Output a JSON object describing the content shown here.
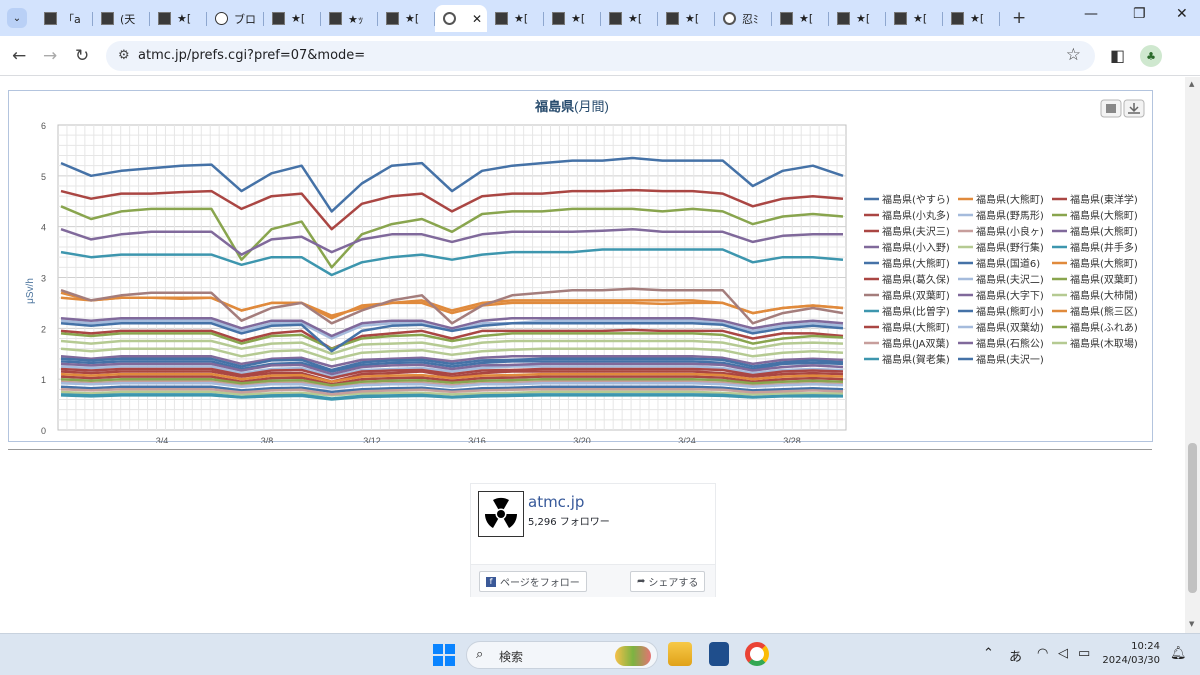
{
  "browser": {
    "tabs": [
      {
        "label": "「a",
        "icon": "square-favicon"
      },
      {
        "label": "(天",
        "icon": "square-favicon"
      },
      {
        "label": "★[",
        "icon": "square-favicon"
      },
      {
        "label": "ブロ",
        "icon": "info-favicon"
      },
      {
        "label": "★[",
        "icon": "square-favicon"
      },
      {
        "label": "★ｯ",
        "icon": "square-favicon"
      },
      {
        "label": "★[",
        "icon": "square-favicon"
      },
      {
        "label": "",
        "icon": "globe-favicon",
        "active": true
      },
      {
        "label": "★[",
        "icon": "square-favicon"
      },
      {
        "label": "★[",
        "icon": "square-favicon"
      },
      {
        "label": "★[",
        "icon": "square-favicon"
      },
      {
        "label": "★[",
        "icon": "square-favicon"
      },
      {
        "label": "忍ﾐ",
        "icon": "globe-favicon"
      },
      {
        "label": "★[",
        "icon": "square-favicon"
      },
      {
        "label": "★[",
        "icon": "square-favicon"
      },
      {
        "label": "★[",
        "icon": "square-favicon"
      },
      {
        "label": "★[",
        "icon": "square-favicon"
      }
    ],
    "close_tab": "✕",
    "new_tab": "+",
    "url": "atmc.jp/prefs.cgi?pref=07&mode="
  },
  "chart_data": {
    "type": "line",
    "title": "福島県",
    "title_suffix": "(月間)",
    "ylabel": "μSv/h",
    "ylim": [
      0,
      6
    ],
    "yticks": [
      "0",
      "1",
      "2",
      "3",
      "4",
      "5",
      "6"
    ],
    "xticks": [
      "3/4",
      "3/8",
      "3/12",
      "3/16",
      "3/20",
      "3/24",
      "3/28"
    ],
    "grid": true,
    "legend_position": "right",
    "series": [
      {
        "name": "福島県(やすら)",
        "color": "#4572a7",
        "values": [
          5.25,
          5.0,
          5.1,
          5.15,
          5.2,
          5.22,
          4.7,
          5.05,
          5.2,
          4.3,
          4.85,
          5.2,
          5.25,
          4.7,
          5.1,
          5.2,
          5.25,
          5.3,
          5.3,
          5.35,
          5.3,
          5.3,
          5.3,
          4.8,
          5.1,
          5.2,
          5.0
        ]
      },
      {
        "name": "福島県(大熊町)",
        "color": "#e08a3c",
        "values": [
          2.6,
          2.55,
          2.6,
          2.6,
          2.58,
          2.6,
          2.35,
          2.5,
          2.5,
          2.25,
          2.4,
          2.5,
          2.5,
          2.3,
          2.45,
          2.5,
          2.5,
          2.5,
          2.5,
          2.5,
          2.48,
          2.5,
          2.5,
          2.3,
          2.4,
          2.45,
          2.4
        ]
      },
      {
        "name": "福島県(東洋学)",
        "color": "#aa4643",
        "values": [
          4.7,
          4.55,
          4.65,
          4.65,
          4.68,
          4.7,
          4.35,
          4.6,
          4.65,
          3.95,
          4.45,
          4.6,
          4.65,
          4.3,
          4.6,
          4.65,
          4.65,
          4.7,
          4.7,
          4.72,
          4.7,
          4.7,
          4.65,
          4.4,
          4.55,
          4.6,
          4.55
        ]
      },
      {
        "name": "福島県(小丸多)",
        "color": "#aa4643",
        "values": [
          1.95,
          1.9,
          1.95,
          1.95,
          1.95,
          1.95,
          1.75,
          1.9,
          1.95,
          1.6,
          1.85,
          1.9,
          1.95,
          1.8,
          1.95,
          1.95,
          1.95,
          1.95,
          1.95,
          1.97,
          1.95,
          1.95,
          1.95,
          1.8,
          1.9,
          1.9,
          1.85
        ]
      },
      {
        "name": "福島県(野馬形)",
        "color": "#a5bbdc",
        "values": [
          2.15,
          2.1,
          2.15,
          2.15,
          2.15,
          2.15,
          1.95,
          2.1,
          2.1,
          1.8,
          2.05,
          2.1,
          2.1,
          1.95,
          2.1,
          2.1,
          2.15,
          2.15,
          2.15,
          2.15,
          2.15,
          2.15,
          2.1,
          1.95,
          2.05,
          2.1,
          2.05
        ]
      },
      {
        "name": "福島県(大熊町)",
        "color": "#89a54e",
        "values": [
          4.4,
          4.15,
          4.3,
          4.35,
          4.35,
          4.35,
          3.35,
          3.95,
          4.1,
          3.2,
          3.85,
          4.05,
          4.15,
          3.9,
          4.25,
          4.3,
          4.3,
          4.35,
          4.35,
          4.35,
          4.3,
          4.35,
          4.3,
          4.05,
          4.2,
          4.25,
          4.2
        ]
      },
      {
        "name": "福島県(夫沢三)",
        "color": "#aa4643",
        "values": [
          1.15,
          1.12,
          1.15,
          1.15,
          1.15,
          1.15,
          1.05,
          1.12,
          1.12,
          0.95,
          1.1,
          1.12,
          1.15,
          1.05,
          1.12,
          1.15,
          1.15,
          1.15,
          1.15,
          1.15,
          1.15,
          1.15,
          1.12,
          1.05,
          1.1,
          1.12,
          1.1
        ]
      },
      {
        "name": "福島県(小良ヶ)",
        "color": "#c79e9c",
        "values": [
          0.95,
          0.92,
          0.95,
          0.95,
          0.95,
          0.95,
          0.88,
          0.92,
          0.93,
          0.85,
          0.9,
          0.92,
          0.93,
          0.88,
          0.92,
          0.93,
          0.95,
          0.95,
          0.95,
          0.95,
          0.95,
          0.95,
          0.93,
          0.88,
          0.9,
          0.92,
          0.9
        ]
      },
      {
        "name": "福島県(大熊町)",
        "color": "#80699b",
        "values": [
          3.95,
          3.75,
          3.85,
          3.9,
          3.9,
          3.9,
          3.45,
          3.75,
          3.8,
          3.5,
          3.75,
          3.85,
          3.85,
          3.7,
          3.85,
          3.9,
          3.9,
          3.9,
          3.92,
          3.95,
          3.9,
          3.9,
          3.9,
          3.7,
          3.82,
          3.85,
          3.85
        ]
      },
      {
        "name": "福島県(小入野)",
        "color": "#80699b",
        "values": [
          2.2,
          2.15,
          2.2,
          2.2,
          2.2,
          2.2,
          2.0,
          2.15,
          2.15,
          1.85,
          2.1,
          2.15,
          2.15,
          2.0,
          2.15,
          2.2,
          2.2,
          2.2,
          2.2,
          2.2,
          2.2,
          2.2,
          2.15,
          2.0,
          2.1,
          2.15,
          2.1
        ]
      },
      {
        "name": "福島県(野行集)",
        "color": "#b5ca92",
        "values": [
          1.75,
          1.7,
          1.75,
          1.75,
          1.75,
          1.75,
          1.6,
          1.7,
          1.72,
          1.5,
          1.68,
          1.7,
          1.72,
          1.62,
          1.72,
          1.75,
          1.75,
          1.75,
          1.75,
          1.75,
          1.75,
          1.75,
          1.72,
          1.6,
          1.7,
          1.72,
          1.7
        ]
      },
      {
        "name": "福島県(井手多)",
        "color": "#3d96ae",
        "values": [
          3.5,
          3.4,
          3.45,
          3.45,
          3.45,
          3.45,
          3.25,
          3.4,
          3.4,
          3.05,
          3.3,
          3.4,
          3.45,
          3.35,
          3.45,
          3.5,
          3.5,
          3.5,
          3.55,
          3.55,
          3.55,
          3.55,
          3.55,
          3.3,
          3.4,
          3.4,
          3.35
        ]
      },
      {
        "name": "福島県(大熊町)",
        "color": "#4572a7",
        "values": [
          1.35,
          1.32,
          1.35,
          1.35,
          1.35,
          1.35,
          1.2,
          1.3,
          1.32,
          1.15,
          1.28,
          1.32,
          1.33,
          1.25,
          1.32,
          1.35,
          1.35,
          1.35,
          1.35,
          1.35,
          1.35,
          1.35,
          1.32,
          1.2,
          1.3,
          1.32,
          1.3
        ]
      },
      {
        "name": "福島県(国道6)",
        "color": "#4572a7",
        "values": [
          0.85,
          0.82,
          0.85,
          0.85,
          0.85,
          0.85,
          0.78,
          0.82,
          0.83,
          0.75,
          0.8,
          0.82,
          0.83,
          0.78,
          0.82,
          0.83,
          0.85,
          0.85,
          0.85,
          0.85,
          0.85,
          0.85,
          0.83,
          0.78,
          0.8,
          0.82,
          0.8
        ]
      },
      {
        "name": "福島県(大熊町)",
        "color": "#e08a3c",
        "values": [
          2.7,
          2.55,
          2.6,
          2.6,
          2.6,
          2.6,
          2.35,
          2.5,
          2.5,
          2.2,
          2.45,
          2.5,
          2.55,
          2.35,
          2.5,
          2.55,
          2.55,
          2.55,
          2.55,
          2.55,
          2.55,
          2.55,
          2.5,
          2.3,
          2.4,
          2.45,
          2.4
        ]
      },
      {
        "name": "福島県(葛久保)",
        "color": "#aa4643",
        "values": [
          1.05,
          1.02,
          1.05,
          1.05,
          1.05,
          1.05,
          0.95,
          1.02,
          1.03,
          0.9,
          1.0,
          1.02,
          1.03,
          0.97,
          1.02,
          1.03,
          1.05,
          1.05,
          1.05,
          1.05,
          1.05,
          1.05,
          1.03,
          0.95,
          1.0,
          1.02,
          1.0
        ]
      },
      {
        "name": "福島県(夫沢二)",
        "color": "#a5bbdc",
        "values": [
          1.25,
          1.22,
          1.25,
          1.25,
          1.25,
          1.25,
          1.12,
          1.2,
          1.22,
          1.05,
          1.18,
          1.2,
          1.22,
          1.15,
          1.22,
          1.25,
          1.25,
          1.25,
          1.25,
          1.25,
          1.25,
          1.25,
          1.22,
          1.12,
          1.18,
          1.2,
          1.18
        ]
      },
      {
        "name": "福島県(双葉町)",
        "color": "#89a54e",
        "values": [
          1.9,
          1.85,
          1.9,
          1.9,
          1.9,
          1.9,
          1.7,
          1.85,
          1.87,
          1.6,
          1.8,
          1.85,
          1.87,
          1.75,
          1.85,
          1.9,
          1.9,
          1.9,
          1.9,
          1.9,
          1.9,
          1.9,
          1.87,
          1.7,
          1.8,
          1.85,
          1.82
        ]
      },
      {
        "name": "福島県(双葉町)",
        "color": "#a47d7c",
        "values": [
          2.75,
          2.55,
          2.65,
          2.7,
          2.7,
          2.7,
          2.15,
          2.4,
          2.5,
          2.1,
          2.35,
          2.55,
          2.65,
          2.1,
          2.45,
          2.65,
          2.7,
          2.75,
          2.75,
          2.78,
          2.75,
          2.75,
          2.75,
          2.1,
          2.3,
          2.4,
          2.3
        ]
      },
      {
        "name": "福島県(大字下)",
        "color": "#80699b",
        "values": [
          1.45,
          1.4,
          1.45,
          1.45,
          1.45,
          1.45,
          1.3,
          1.4,
          1.42,
          1.25,
          1.38,
          1.4,
          1.42,
          1.35,
          1.42,
          1.45,
          1.45,
          1.45,
          1.45,
          1.45,
          1.45,
          1.45,
          1.42,
          1.3,
          1.38,
          1.4,
          1.38
        ]
      },
      {
        "name": "福島県(大柿閒)",
        "color": "#b5ca92",
        "values": [
          0.75,
          0.72,
          0.75,
          0.75,
          0.75,
          0.75,
          0.7,
          0.72,
          0.73,
          0.68,
          0.72,
          0.73,
          0.73,
          0.7,
          0.72,
          0.73,
          0.75,
          0.75,
          0.75,
          0.75,
          0.75,
          0.75,
          0.73,
          0.7,
          0.72,
          0.72,
          0.72
        ]
      },
      {
        "name": "福島県(比曽字)",
        "color": "#3d96ae",
        "values": [
          0.68,
          0.66,
          0.68,
          0.68,
          0.68,
          0.68,
          0.64,
          0.66,
          0.67,
          0.6,
          0.65,
          0.66,
          0.67,
          0.64,
          0.66,
          0.67,
          0.68,
          0.68,
          0.68,
          0.68,
          0.68,
          0.68,
          0.67,
          0.64,
          0.66,
          0.66,
          0.66
        ]
      },
      {
        "name": "福島県(熊町小)",
        "color": "#4572a7",
        "values": [
          2.1,
          2.05,
          2.1,
          2.1,
          2.1,
          2.1,
          1.9,
          2.05,
          2.07,
          1.55,
          1.95,
          2.05,
          2.07,
          1.95,
          2.05,
          2.1,
          2.1,
          2.1,
          2.1,
          2.1,
          2.1,
          2.1,
          2.07,
          1.9,
          2.0,
          2.05,
          2.0
        ]
      },
      {
        "name": "福島県(熊三区)",
        "color": "#e08a3c",
        "values": [
          1.1,
          1.07,
          1.1,
          1.1,
          1.1,
          1.1,
          1.0,
          1.07,
          1.08,
          0.95,
          1.05,
          1.07,
          1.08,
          1.02,
          1.07,
          1.08,
          1.1,
          1.1,
          1.1,
          1.1,
          1.1,
          1.1,
          1.08,
          1.0,
          1.05,
          1.07,
          1.05
        ]
      },
      {
        "name": "福島県(大熊町)",
        "color": "#aa4643",
        "values": [
          1.2,
          1.17,
          1.2,
          1.2,
          1.2,
          1.2,
          1.08,
          1.17,
          1.18,
          1.02,
          1.15,
          1.17,
          1.18,
          1.1,
          1.17,
          1.18,
          1.2,
          1.2,
          1.2,
          1.2,
          1.2,
          1.2,
          1.18,
          1.08,
          1.15,
          1.17,
          1.15
        ]
      },
      {
        "name": "福島県(双葉幼)",
        "color": "#a5bbdc",
        "values": [
          0.92,
          0.9,
          0.92,
          0.92,
          0.92,
          0.92,
          0.85,
          0.9,
          0.9,
          0.82,
          0.88,
          0.9,
          0.9,
          0.85,
          0.9,
          0.9,
          0.92,
          0.92,
          0.92,
          0.92,
          0.92,
          0.92,
          0.9,
          0.85,
          0.88,
          0.9,
          0.88
        ]
      },
      {
        "name": "福島県(ふれあ)",
        "color": "#89a54e",
        "values": [
          1.0,
          0.97,
          1.0,
          1.0,
          1.0,
          1.0,
          0.92,
          0.97,
          0.98,
          0.88,
          0.95,
          0.97,
          0.98,
          0.93,
          0.97,
          0.98,
          1.0,
          1.0,
          1.0,
          1.0,
          1.0,
          1.0,
          0.98,
          0.92,
          0.95,
          0.97,
          0.95
        ]
      },
      {
        "name": "福島県(JA双葉)",
        "color": "#c79e9c",
        "values": [
          0.8,
          0.78,
          0.8,
          0.8,
          0.8,
          0.8,
          0.74,
          0.78,
          0.79,
          0.7,
          0.76,
          0.78,
          0.79,
          0.75,
          0.78,
          0.79,
          0.8,
          0.8,
          0.8,
          0.8,
          0.8,
          0.8,
          0.79,
          0.74,
          0.76,
          0.78,
          0.76
        ]
      },
      {
        "name": "福島県(石熊公)",
        "color": "#80699b",
        "values": [
          1.3,
          1.27,
          1.3,
          1.3,
          1.3,
          1.3,
          1.17,
          1.27,
          1.28,
          1.1,
          1.24,
          1.27,
          1.28,
          1.2,
          1.27,
          1.28,
          1.3,
          1.3,
          1.3,
          1.3,
          1.3,
          1.3,
          1.28,
          1.17,
          1.24,
          1.27,
          1.24
        ]
      },
      {
        "name": "福島県(木取場)",
        "color": "#b5ca92",
        "values": [
          1.6,
          1.55,
          1.6,
          1.6,
          1.6,
          1.6,
          1.45,
          1.55,
          1.57,
          1.38,
          1.52,
          1.55,
          1.57,
          1.48,
          1.55,
          1.58,
          1.6,
          1.6,
          1.6,
          1.6,
          1.6,
          1.6,
          1.57,
          1.45,
          1.52,
          1.55,
          1.52
        ]
      },
      {
        "name": "福島県(賀老集)",
        "color": "#3d96ae",
        "values": [
          0.7,
          0.68,
          0.7,
          0.7,
          0.7,
          0.7,
          0.65,
          0.68,
          0.69,
          0.62,
          0.67,
          0.68,
          0.69,
          0.65,
          0.68,
          0.69,
          0.7,
          0.7,
          0.7,
          0.7,
          0.7,
          0.7,
          0.69,
          0.65,
          0.67,
          0.68,
          0.67
        ]
      },
      {
        "name": "福島県(夫沢一)",
        "color": "#4572a7",
        "values": [
          1.4,
          1.37,
          1.4,
          1.4,
          1.4,
          1.4,
          1.25,
          1.37,
          1.38,
          1.18,
          1.33,
          1.37,
          1.38,
          1.3,
          1.37,
          1.38,
          1.4,
          1.4,
          1.4,
          1.4,
          1.4,
          1.4,
          1.38,
          1.25,
          1.33,
          1.37,
          1.33
        ]
      }
    ]
  },
  "widget": {
    "name": "atmc.jp",
    "followers": "5,296 フォロワー",
    "follow_label": "ページをフォロー",
    "share_label": "シェアする"
  },
  "taskbar": {
    "search_placeholder": "検索",
    "ime": "あ",
    "time": "10:24",
    "date": "2024/03/30"
  }
}
